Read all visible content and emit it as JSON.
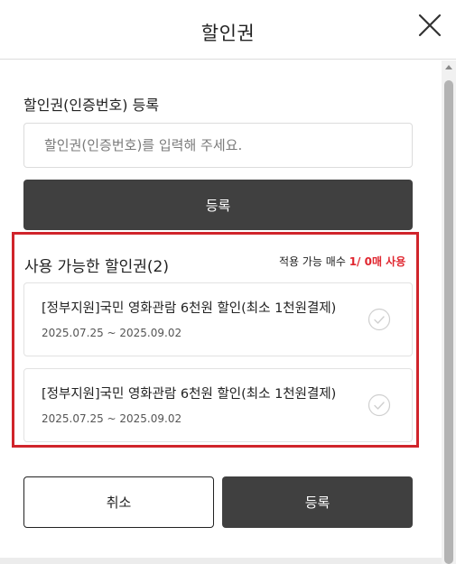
{
  "header": {
    "title": "할인권",
    "close_icon": "close-icon"
  },
  "register": {
    "label": "할인권(인증번호) 등록",
    "input_value": "",
    "input_placeholder": "할인권(인증번호)를 입력해 주세요.",
    "button_label": "등록"
  },
  "coupons": {
    "title": "사용 가능한 할인권(2)",
    "count_prefix": "적용 가능 매수 ",
    "count_value": "1/ 0매 사용",
    "highlight_color": "#e0262f",
    "items": [
      {
        "title": "[정부지원]국민 영화관람 6천원 할인(최소 1천원결제)",
        "date": "2025.07.25 ~ 2025.09.02",
        "checked": false
      },
      {
        "title": "[정부지원]국민 영화관람 6천원 할인(최소 1천원결제)",
        "date": "2025.07.25 ~ 2025.09.02",
        "checked": false
      }
    ]
  },
  "footer": {
    "cancel_label": "취소",
    "submit_label": "등록"
  },
  "colors": {
    "primary_button": "#404040",
    "focus_outline": "#d0242b"
  }
}
